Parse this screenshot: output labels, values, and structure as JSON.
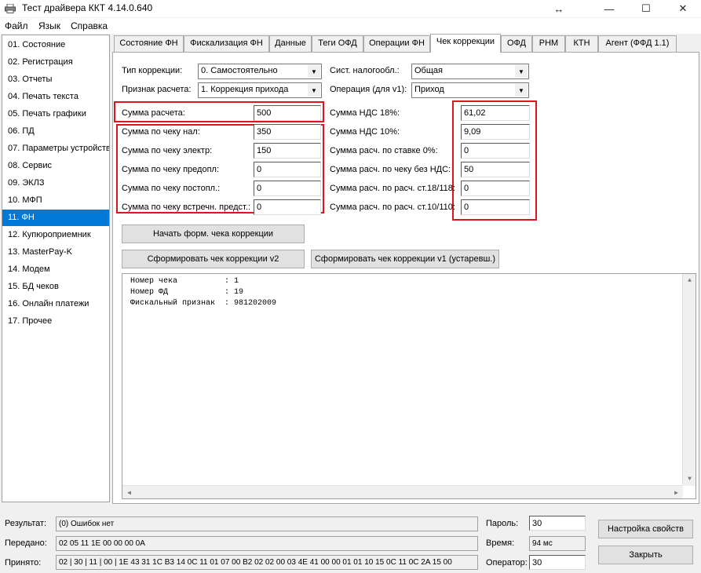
{
  "window": {
    "title": "Тест драйвера ККТ 4.14.0.640",
    "controls": {
      "move": "↔",
      "minimize": "—",
      "maximize": "☐",
      "close": "✕"
    }
  },
  "menu": [
    "Файл",
    "Язык",
    "Справка"
  ],
  "sidebar": {
    "items": [
      "01. Состояние",
      "02. Регистрация",
      "03. Отчеты",
      "04. Печать текста",
      "05. Печать графики",
      "06. ПД",
      "07. Параметры устройства",
      "08. Сервис",
      "09. ЭКЛЗ",
      "10. МФП",
      "11. ФН",
      "12. Купюроприемник",
      "13. MasterPay-K",
      "14. Модем",
      "15. БД чеков",
      "16. Онлайн платежи",
      "17. Прочее"
    ],
    "selected_index": 10
  },
  "tabs": [
    "Состояние ФН",
    "Фискализация ФН",
    "Данные",
    "Теги ОФД",
    "Операции ФН",
    "Чек коррекции",
    "ОФД",
    "РНМ",
    "КТН",
    "Агент (ФФД 1.1)"
  ],
  "active_tab_index": 5,
  "form": {
    "correction_type": {
      "label": "Тип коррекции:",
      "value": "0. Самостоятельно"
    },
    "calc_sign": {
      "label": "Признак расчета:",
      "value": "1. Коррекция прихода"
    },
    "tax_system": {
      "label": "Сист. налогообл.:",
      "value": "Общая"
    },
    "operation": {
      "label": "Операция (для v1):",
      "value": "Приход"
    },
    "sum_calc": {
      "label": "Сумма расчета:",
      "value": "500"
    },
    "sum_cash": {
      "label": "Сумма по чеку нал:",
      "value": "350"
    },
    "sum_electronic": {
      "label": "Сумма по чеку электр:",
      "value": "150"
    },
    "sum_prepaid": {
      "label": "Сумма по чеку предопл:",
      "value": "0"
    },
    "sum_postpaid": {
      "label": "Сумма по чеку постопл.:",
      "value": "0"
    },
    "sum_counter": {
      "label": "Сумма по чеку встречн. предст.:",
      "value": "0"
    },
    "vat18": {
      "label": "Сумма НДС 18%:",
      "value": "61,02"
    },
    "vat10": {
      "label": "Сумма НДС 10%:",
      "value": "9,09"
    },
    "calc_rate0": {
      "label": "Сумма расч. по ставке 0%:",
      "value": "0"
    },
    "calc_novat": {
      "label": "Сумма расч. по чеку без НДС:",
      "value": "50"
    },
    "calc_18_118": {
      "label": "Сумма расч. по расч. ст.18/118:",
      "value": "0"
    },
    "calc_10_110": {
      "label": "Сумма расч. по расч. ст.10/110:",
      "value": "0"
    }
  },
  "buttons": {
    "start": "Начать форм. чека коррекции",
    "form_v2": "Сформировать чек коррекции v2",
    "form_v1": "Сформировать чек коррекции v1 (устаревш.)",
    "settings": "Настройка свойств",
    "close": "Закрыть"
  },
  "log": [
    "Номер чека          : 1",
    "Номер ФД            : 19",
    "Фискальный признак  : 981202009"
  ],
  "status": {
    "result_label": "Результат:",
    "result_value": "(0) Ошибок нет",
    "sent_label": "Передано:",
    "sent_value": "02 05 11 1E 00 00 00 0A",
    "received_label": "Принято:",
    "received_value": "02 | 30 | 11 | 00 | 1E 43 31 1C B3 14 0C 11 01 07 00 B2 02 02 00 03 4E 41 00 00 01 01 10 15 0C 11 0C 2A 15 00",
    "password_label": "Пароль:",
    "password_value": "30",
    "time_label": "Время:",
    "time_value": "94 мс",
    "operator_label": "Оператор:",
    "operator_value": "30"
  },
  "colors": {
    "accent": "#0078d7",
    "highlight": "#e0141e"
  }
}
